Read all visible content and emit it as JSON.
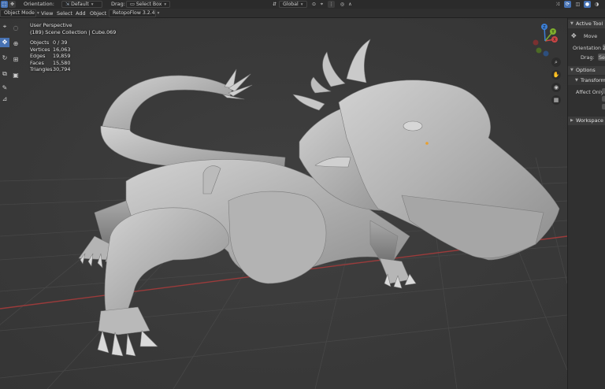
{
  "tool_header": {
    "orientation_label": "Orientation:",
    "orientation_value": "Default",
    "drag_label": "Drag:",
    "drag_value": "Select Box",
    "transform_orientation": "Global"
  },
  "menu": {
    "mode": "Object Mode",
    "items": [
      "View",
      "Select",
      "Add",
      "Object"
    ],
    "addon": "RetopoFlow 3.2.4"
  },
  "viewport_info": {
    "perspective": "User Perspective",
    "collection": "(189) Scene Collection | Cube.069"
  },
  "stats": [
    {
      "key": "Objects",
      "value": "0 / 39"
    },
    {
      "key": "Vertices",
      "value": "16,063"
    },
    {
      "key": "Edges",
      "value": "19,859"
    },
    {
      "key": "Faces",
      "value": "15,580"
    },
    {
      "key": "Triangles",
      "value": "30,794"
    }
  ],
  "gizmo": {
    "x": "X",
    "y": "Y",
    "z": "Z"
  },
  "npanel": {
    "active_tool": "Active Tool",
    "move": "Move",
    "orientation_label": "Orientation",
    "orientation_value": "2",
    "drag_label": "Drag:",
    "drag_value": "Se",
    "options": "Options",
    "transform": "Transform",
    "affect_only": "Affect Only",
    "workspace": "Workspace"
  },
  "colors": {
    "axis_x": "#c94545",
    "axis_y": "#7eae2d",
    "axis_z": "#3c7fd6",
    "accent": "#4772b3",
    "mesh": "#bdbdbd"
  },
  "icons": [
    "cursor-icon",
    "move-icon",
    "rotate-icon",
    "scale-icon",
    "transform-icon",
    "annotate-icon",
    "measure-icon",
    "zoom-icon",
    "hand-icon",
    "camera-icon",
    "grid-view-icon"
  ]
}
